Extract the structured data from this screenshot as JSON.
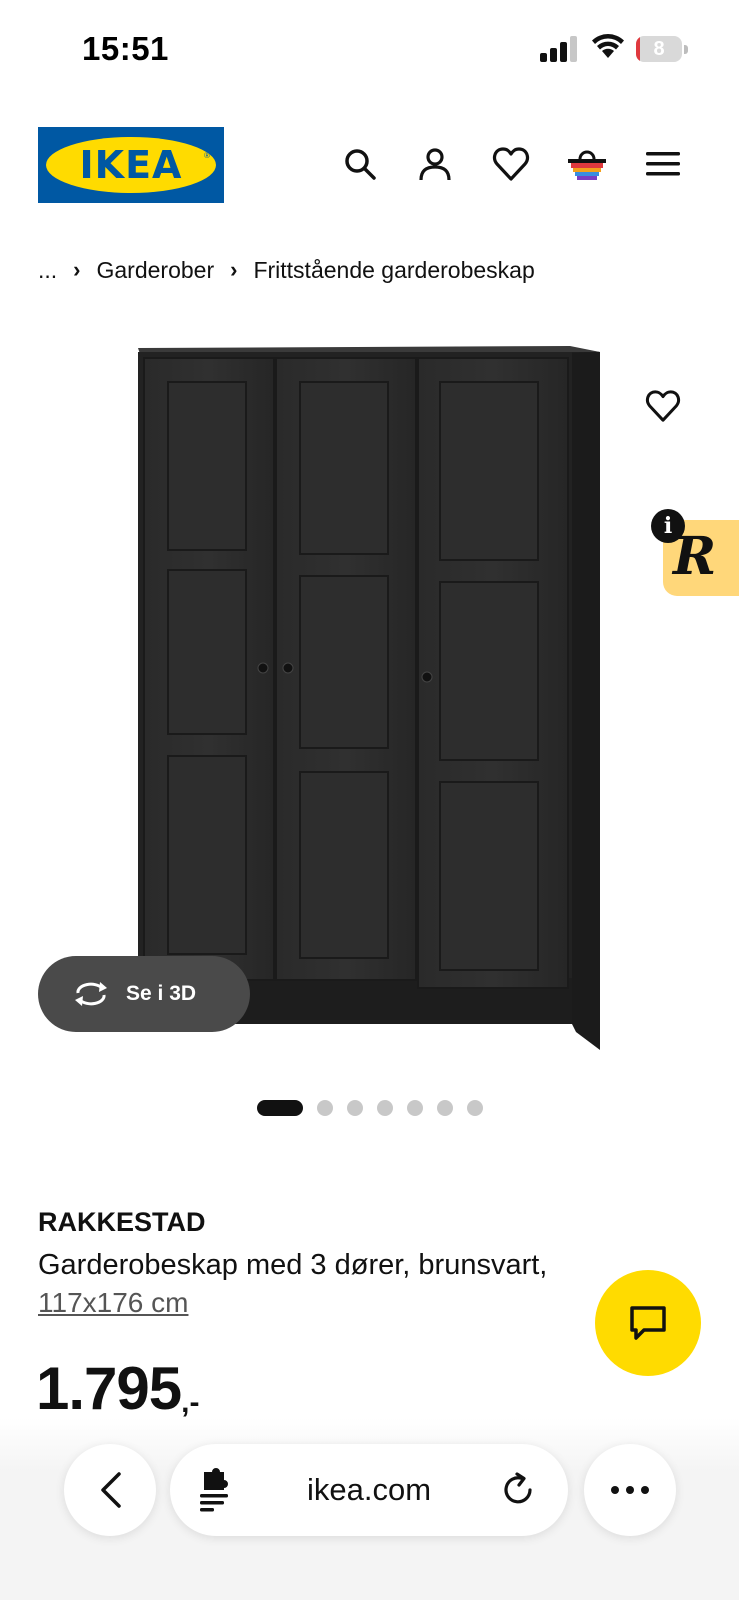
{
  "status_bar": {
    "time": "15:51",
    "battery_level": "8",
    "battery_fraction": 0.08,
    "battery_color": "#e0393e"
  },
  "header": {
    "logo_text": "IKEA",
    "logo_colors": {
      "blue": "#0058a3",
      "yellow": "#ffdb00"
    },
    "icons": [
      "search-icon",
      "account-icon",
      "heart-icon",
      "basket-icon",
      "menu-icon"
    ]
  },
  "breadcrumb": {
    "items": [
      "...",
      "Garderober",
      "Frittstående garderobeskap"
    ]
  },
  "gallery": {
    "view_3d_label": "Se i 3D",
    "page_count": 7,
    "active_page": 1,
    "extension_badge_letter": "R",
    "info_glyph": "i"
  },
  "product": {
    "name": "RAKKESTAD",
    "description": "Garderobeskap med 3 dører, brunsvart,",
    "size": "117x176 cm",
    "price": "1.795",
    "price_suffix": ",-"
  },
  "browser": {
    "url": "ikea.com"
  }
}
